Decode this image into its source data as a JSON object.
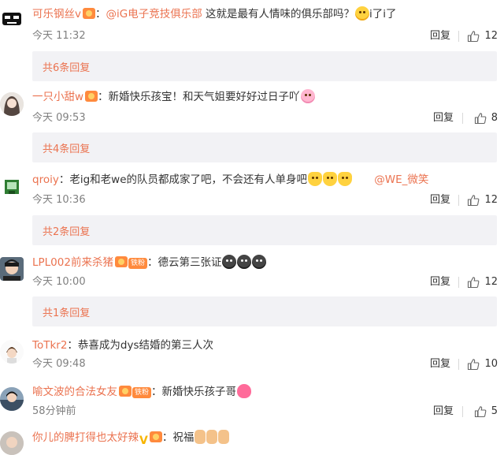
{
  "colors": {
    "username": "#eb7350",
    "text": "#333333",
    "muted": "#808080",
    "panel": "#f2f2f5"
  },
  "actions": {
    "reply_label": "回复"
  },
  "comments": [
    {
      "user": "可乐钢丝v",
      "mention": "@iG电子竞技俱乐部",
      "text": "这就是最有人情味的俱乐部吗？",
      "text_after": "i了i了",
      "time": "今天 11:32",
      "likes": "12",
      "more_replies": "共6条回复"
    },
    {
      "user": "一只小甜w",
      "text": "新婚快乐孩宝！和天气姐要好好过日子吖",
      "time": "今天 09:53",
      "likes": "8",
      "more_replies": "共4条回复"
    },
    {
      "user": "qroiy",
      "text": "老ig和老we的队员都成家了吧，不会还有人单身吧",
      "mention_after": "@WE_微笑",
      "time": "今天 10:36",
      "likes": "12",
      "more_replies": "共2条回复"
    },
    {
      "user": "LPL002前来杀猪",
      "badge": "铁粉",
      "text": "德云第三张证",
      "time": "今天 10:00",
      "likes": "12",
      "more_replies": "共1条回复"
    },
    {
      "user": "ToTkr2",
      "text": "恭喜成为dys结婚的第三人次",
      "time": "今天 09:48",
      "likes": "10"
    },
    {
      "user": "喻文波的合法女友",
      "badge": "铁粉",
      "text": "新婚快乐孩子哥",
      "time": "58分钟前",
      "likes": "5"
    },
    {
      "user": "你儿的脾打得也太好辣",
      "text": "祝福"
    }
  ]
}
